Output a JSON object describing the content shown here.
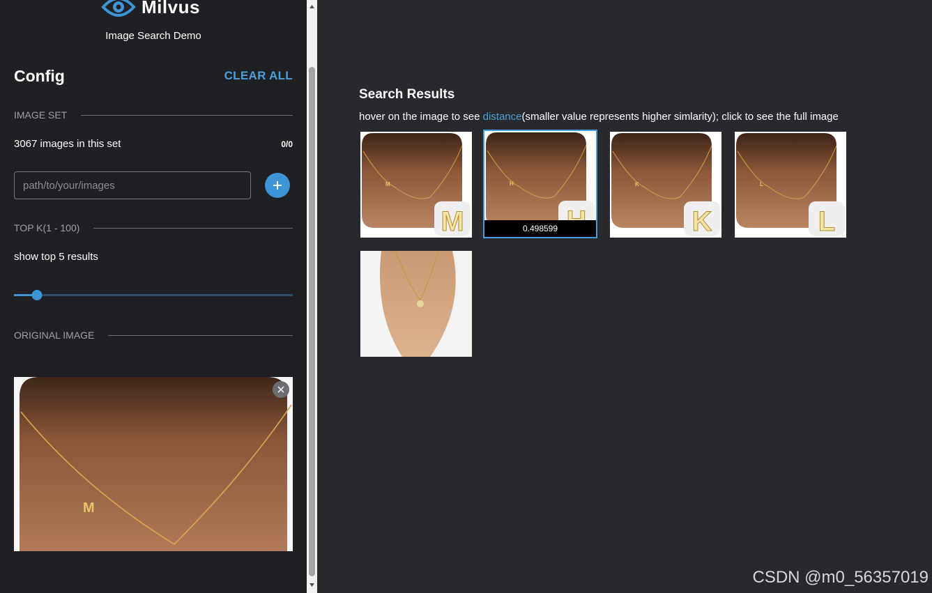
{
  "brand": {
    "name": "Milvus",
    "subtitle": "Image Search Demo"
  },
  "sidebar": {
    "config_title": "Config",
    "clear_all_label": "CLEAR ALL",
    "image_set": {
      "section_label": "IMAGE SET",
      "count_text": "3067 images in this set",
      "ratio_text": "0/0",
      "path_placeholder": "path/to/your/images",
      "add_icon": "plus-icon"
    },
    "top_k": {
      "section_label": "TOP K(1 - 100)",
      "summary_text": "show top 5 results",
      "value": 5,
      "min": 1,
      "max": 100
    },
    "original_image": {
      "section_label": "ORIGINAL IMAGE",
      "letter": "M",
      "close_icon": "close-icon"
    }
  },
  "results": {
    "title": "Search Results",
    "hint_prefix": "hover on the image to see ",
    "hint_link": "distance",
    "hint_suffix": "(smaller value represents higher simlarity); click to see the full image",
    "items": [
      {
        "letter": "M",
        "distance": ""
      },
      {
        "letter": "H",
        "distance": "0.498599"
      },
      {
        "letter": "K",
        "distance": ""
      },
      {
        "letter": "L",
        "distance": ""
      },
      {
        "letter": "",
        "distance": ""
      }
    ]
  },
  "watermark": "CSDN @m0_56357019",
  "colors": {
    "accent": "#4a9fd8",
    "sidebar_bg": "#1f2023",
    "main_bg": "#28292e"
  }
}
